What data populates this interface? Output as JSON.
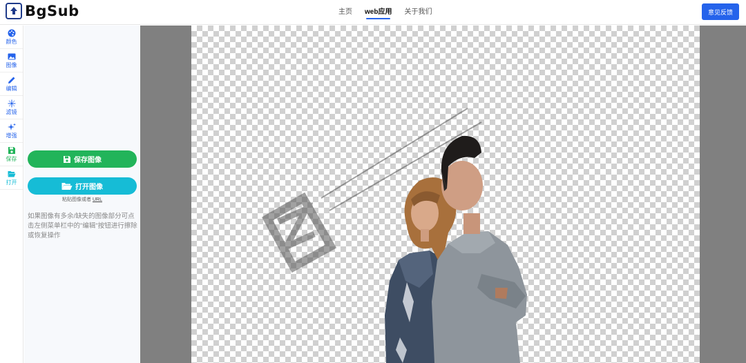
{
  "header": {
    "logo_text": "BgSub",
    "nav": [
      {
        "label": "主页",
        "active": false
      },
      {
        "label": "web应用",
        "active": true
      },
      {
        "label": "关于我们",
        "active": false
      }
    ],
    "feedback_label": "意见反馈",
    "accent_color": "#2563eb"
  },
  "sidebar": {
    "items": [
      {
        "label": "颜色",
        "icon": "palette-icon"
      },
      {
        "label": "图像",
        "icon": "image-icon"
      },
      {
        "label": "编辑",
        "icon": "pencil-icon"
      },
      {
        "label": "滤镜",
        "icon": "filter-icon"
      },
      {
        "label": "增强",
        "icon": "sparkle-icon"
      },
      {
        "label": "保存",
        "icon": "save-icon"
      },
      {
        "label": "打开",
        "icon": "folder-open-icon"
      }
    ]
  },
  "panel": {
    "save_label": "保存图像",
    "open_label": "打开图像",
    "paste_hint_prefix": "粘贴图像或者",
    "paste_hint_url": "URL",
    "help_text": "如果图像有多余/缺失的图像部分可点击左侧菜单栏中的\"编辑\"按钮进行擦除或恢复操作",
    "save_color": "#22b45a",
    "open_color": "#16bcd6"
  }
}
